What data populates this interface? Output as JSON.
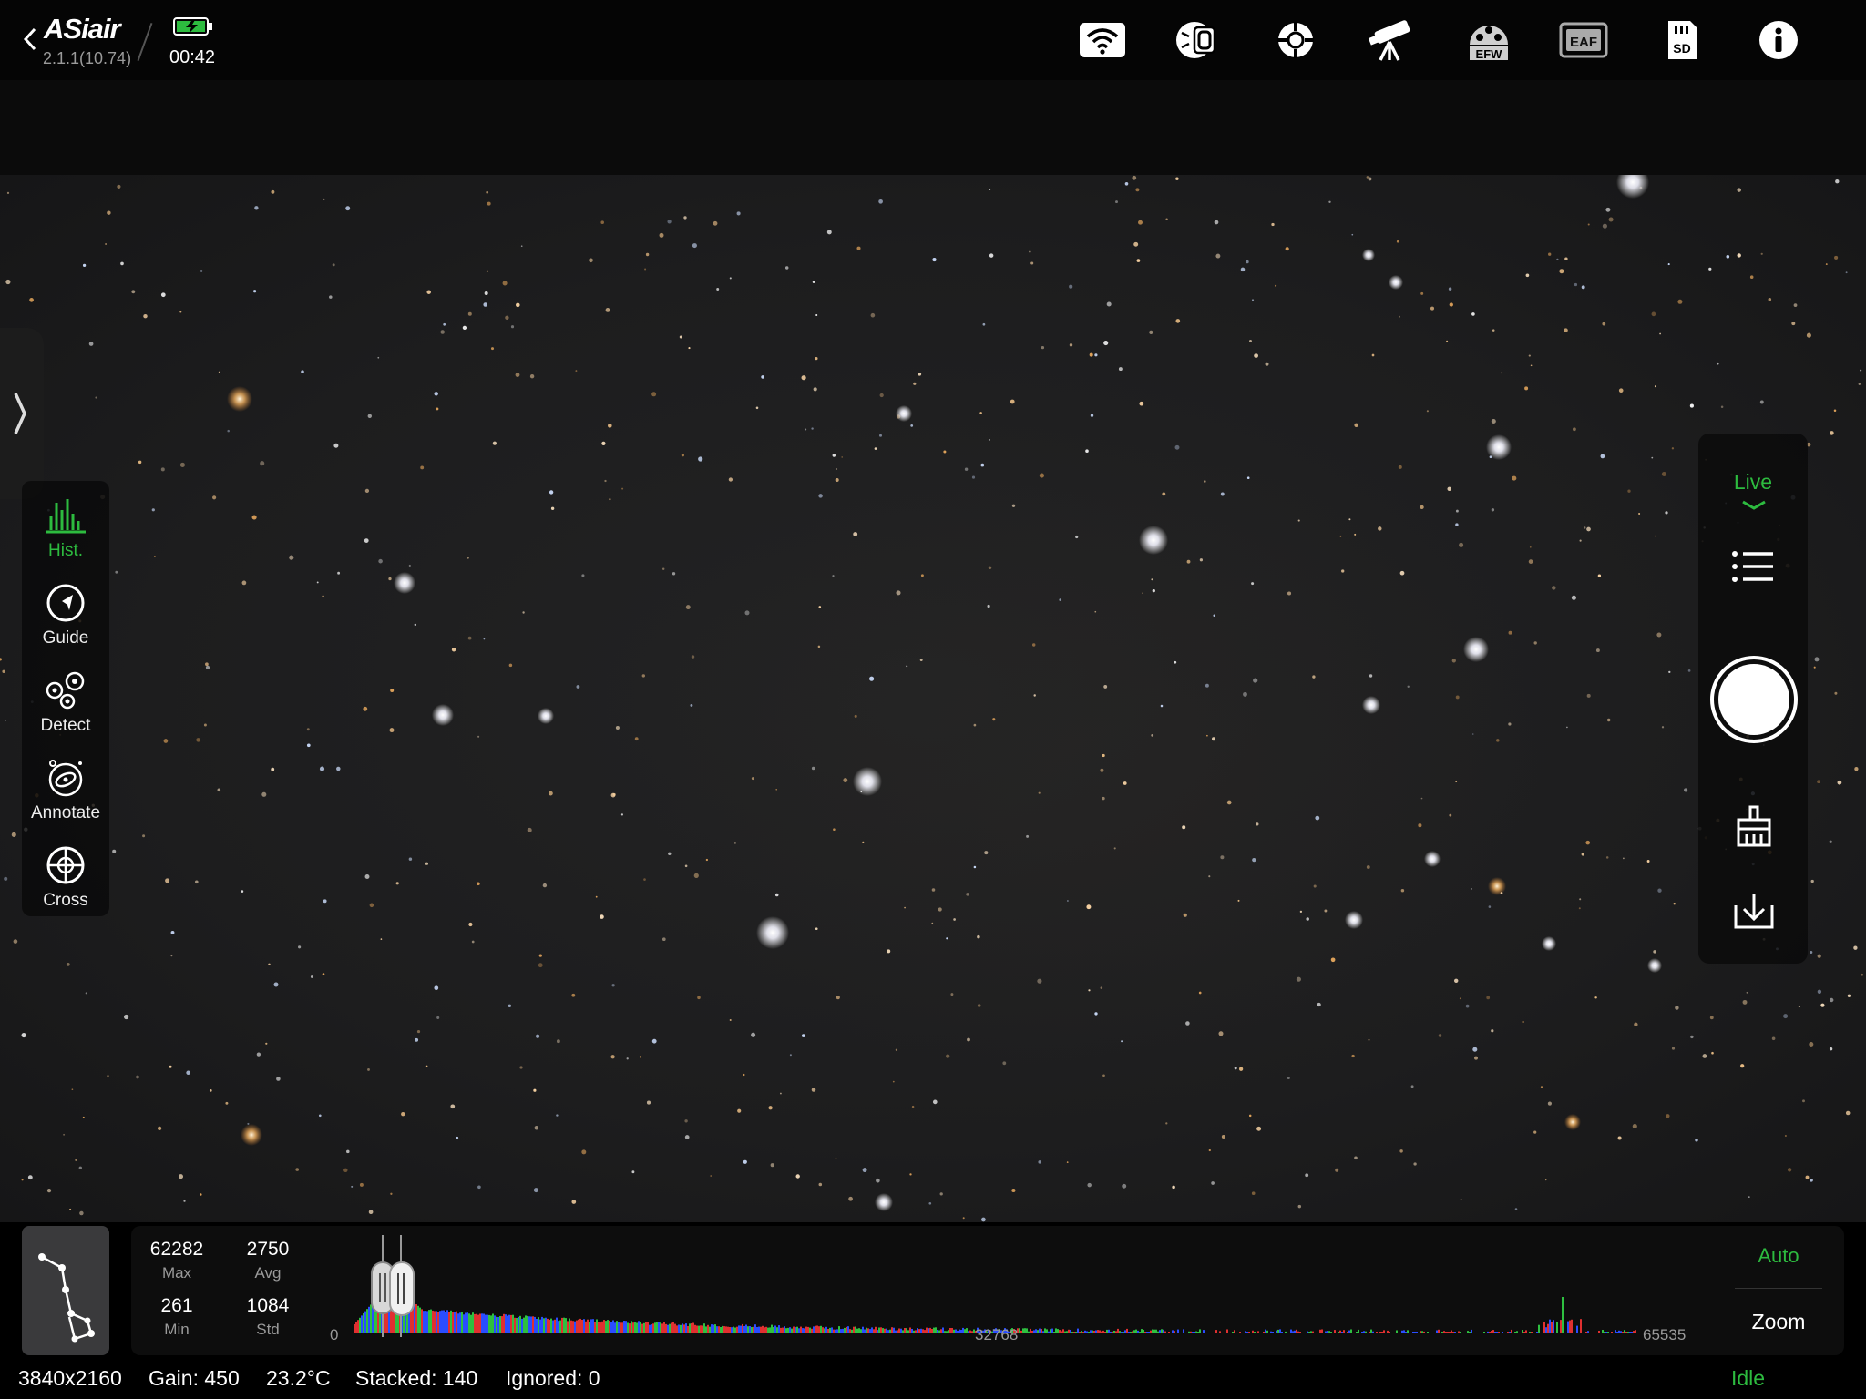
{
  "header": {
    "app_name": "ASiair",
    "version": "2.1.1(10.74)",
    "clock": "00:42",
    "sd_label": "SD",
    "efw_label": "EFW",
    "eaf_label": "EAF",
    "icons": [
      "wifi-icon",
      "camera-icon",
      "guide-scope-icon",
      "telescope-icon",
      "efw-icon",
      "eaf-icon",
      "sd-card-icon",
      "info-icon"
    ]
  },
  "tools": [
    {
      "label": "Hist.",
      "active": true
    },
    {
      "label": "Guide",
      "active": false
    },
    {
      "label": "Detect",
      "active": false
    },
    {
      "label": "Annotate",
      "active": false
    },
    {
      "label": "Cross",
      "active": false
    }
  ],
  "right_panel": {
    "mode_label": "Live"
  },
  "histogram": {
    "max": "62282",
    "max_label": "Max",
    "avg": "2750",
    "avg_label": "Avg",
    "min": "261",
    "min_label": "Min",
    "std": "1084",
    "std_label": "Std",
    "axis_start": "0",
    "axis_mid": "32768",
    "axis_end": "65535",
    "auto_label": "Auto",
    "zoom_label": "Zoom"
  },
  "status": {
    "resolution": "3840x2160",
    "gain": "Gain: 450",
    "temperature": "23.2°C",
    "stacked": "Stacked: 140",
    "ignored": "Ignored: 0",
    "state": "Idle"
  },
  "colors": {
    "accent": "#2dbb3f",
    "panel": "#0d0d0d"
  }
}
